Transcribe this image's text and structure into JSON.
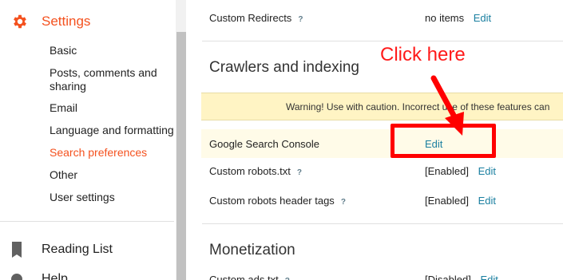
{
  "sidebar": {
    "title": "Settings",
    "items": [
      {
        "label": "Basic",
        "active": false
      },
      {
        "label": "Posts, comments and sharing",
        "active": false
      },
      {
        "label": "Email",
        "active": false
      },
      {
        "label": "Language and formatting",
        "active": false
      },
      {
        "label": "Search preferences",
        "active": true
      },
      {
        "label": "Other",
        "active": false
      },
      {
        "label": "User settings",
        "active": false
      }
    ],
    "reading_list": "Reading List",
    "help": "Help",
    "icons": {
      "settings": "gear-icon",
      "reading_list": "bookmark-icon",
      "help": "help-icon"
    }
  },
  "main": {
    "custom_redirects": {
      "label": "Custom Redirects",
      "help": "?",
      "value": "no items",
      "edit": "Edit"
    },
    "crawlers_section": "Crawlers and indexing",
    "warning": "Warning! Use with caution. Incorrect use of these features can",
    "google_search_console": {
      "label": "Google Search Console",
      "edit": "Edit"
    },
    "custom_robots_txt": {
      "label": "Custom robots.txt",
      "help": "?",
      "value": "[Enabled]",
      "edit": "Edit"
    },
    "custom_robots_header_tags": {
      "label": "Custom robots header tags",
      "help": "?",
      "value": "[Enabled]",
      "edit": "Edit"
    },
    "monetization_section": "Monetization",
    "custom_ads_txt": {
      "label": "Custom ads.txt",
      "help": "?",
      "value": "[Disabled]",
      "edit": "Edit"
    }
  },
  "annotation": {
    "text": "Click here",
    "color": "#ff0000"
  },
  "colors": {
    "accent": "#f4511e",
    "link": "#1a7fa0",
    "warning_bg": "#fff4c4"
  }
}
